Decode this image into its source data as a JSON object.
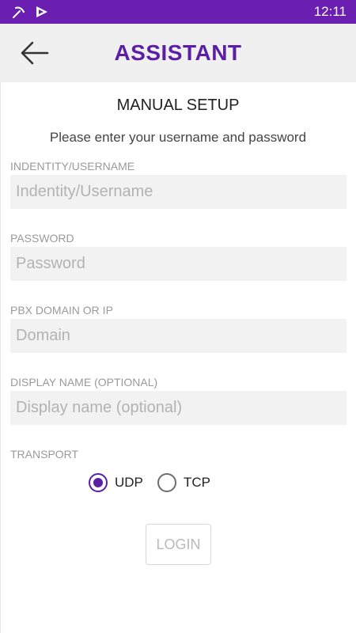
{
  "status_bar": {
    "time": "12:11",
    "icons": [
      "pickaxe-icon",
      "play-store-icon"
    ],
    "background_color": "#6a1fb0"
  },
  "header": {
    "title": "ASSISTANT",
    "back_icon": "arrow-left-icon",
    "title_color": "#5b1fa6"
  },
  "setup": {
    "title": "MANUAL SETUP",
    "subtitle": "Please enter your username and password"
  },
  "fields": {
    "username": {
      "label": "INDENTITY/USERNAME",
      "placeholder": "Indentity/Username",
      "value": ""
    },
    "password": {
      "label": "PASSWORD",
      "placeholder": "Password",
      "value": ""
    },
    "domain": {
      "label": "PBX DOMAIN OR IP",
      "placeholder": "Domain",
      "value": ""
    },
    "display_name": {
      "label": "DISPLAY NAME (OPTIONAL)",
      "placeholder": "Display name (optional)",
      "value": ""
    }
  },
  "transport": {
    "label": "TRANSPORT",
    "options": [
      {
        "label": "UDP",
        "checked": true
      },
      {
        "label": "TCP",
        "checked": false
      }
    ]
  },
  "login_button": {
    "label": "LOGIN",
    "enabled": false
  }
}
